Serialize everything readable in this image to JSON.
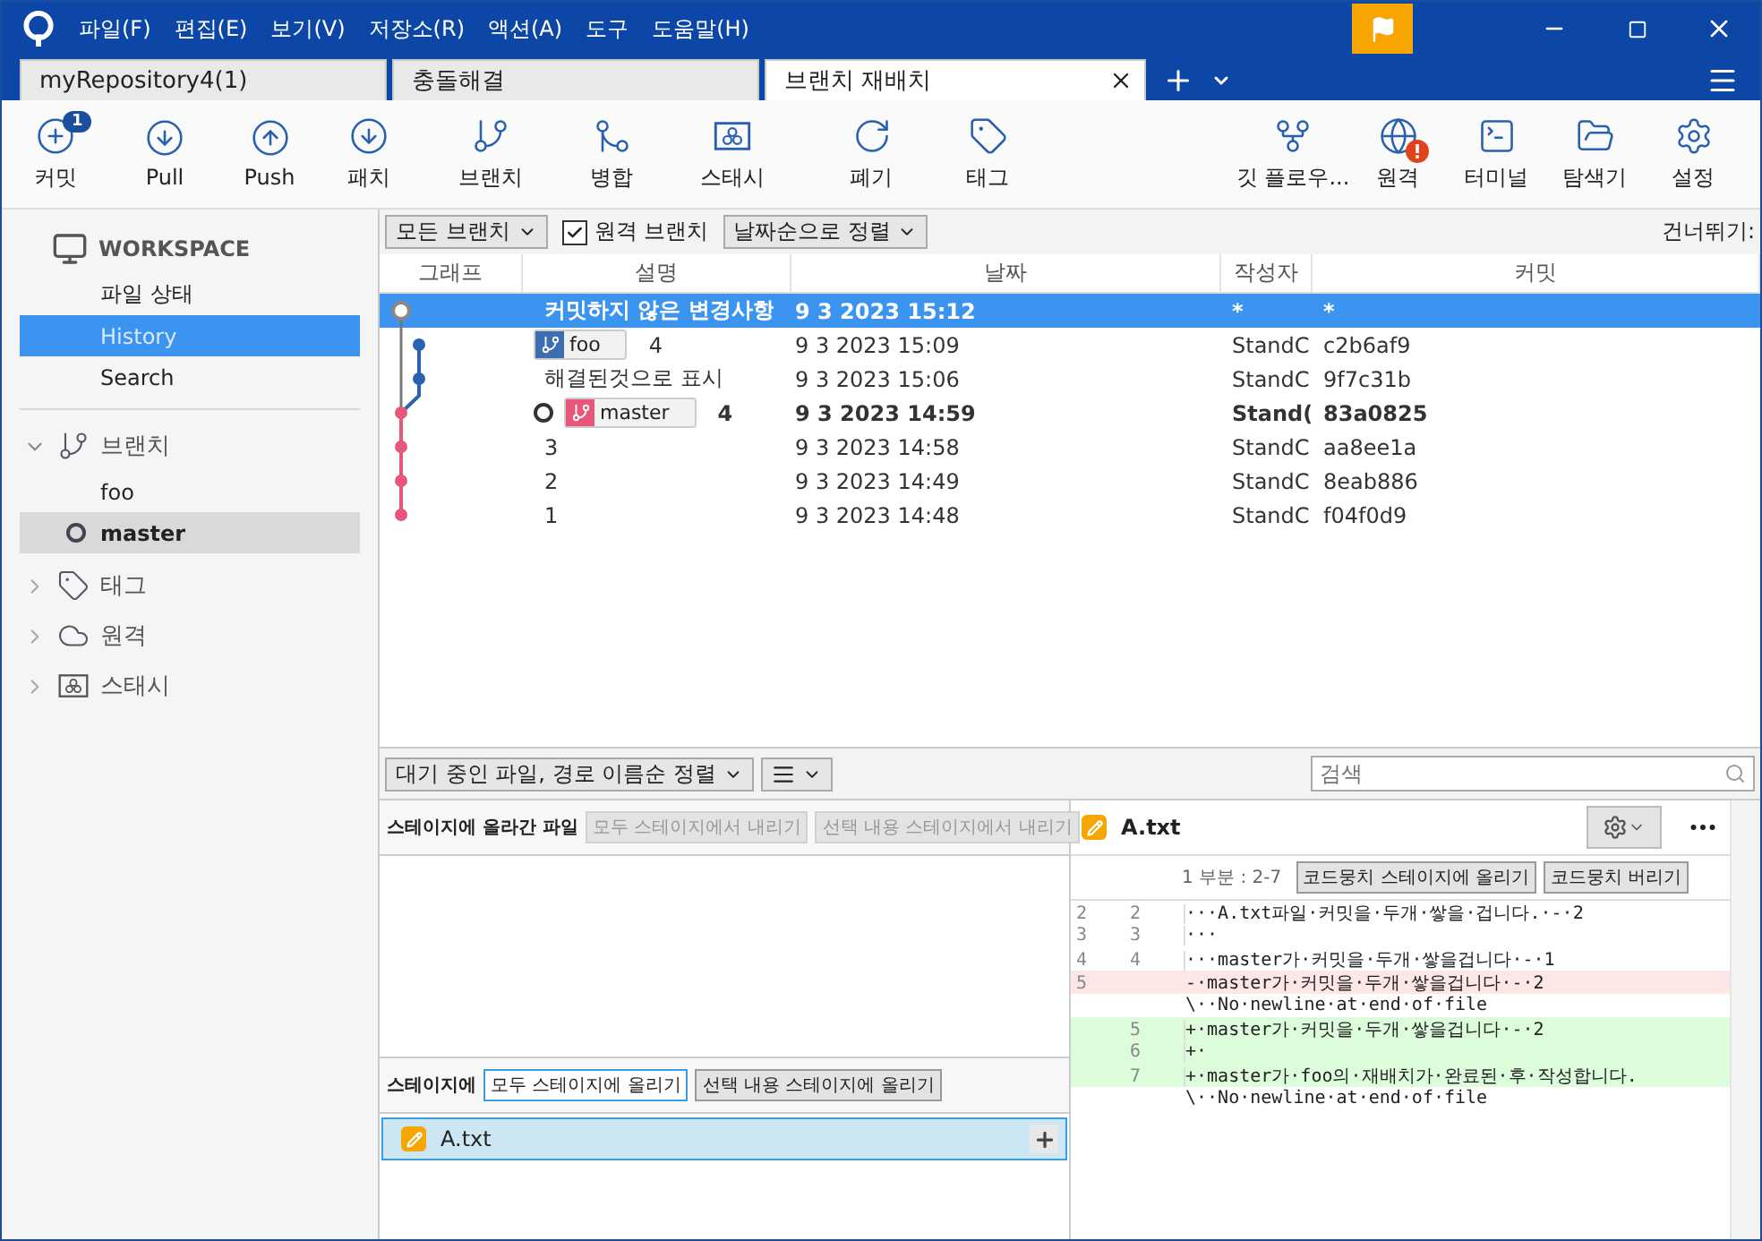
{
  "menu": [
    "파일(F)",
    "편집(E)",
    "보기(V)",
    "저장소(R)",
    "액션(A)",
    "도구",
    "도움말(H)"
  ],
  "tabs": [
    {
      "label": "myRepository4(1)",
      "selected": false
    },
    {
      "label": "충돌해결",
      "selected": false
    },
    {
      "label": "브랜치 재배치",
      "selected": true
    }
  ],
  "toolbar": {
    "left": [
      {
        "label": "커밋",
        "badge": "1"
      },
      {
        "label": "Pull"
      },
      {
        "label": "Push"
      },
      {
        "label": "패치"
      },
      {
        "label": "브랜치"
      },
      {
        "label": "병합"
      },
      {
        "label": "스태시"
      },
      {
        "label": "폐기"
      },
      {
        "label": "태그"
      }
    ],
    "right": [
      {
        "label": "깃 플로우..."
      },
      {
        "label": "원격",
        "alert": true
      },
      {
        "label": "터미널"
      },
      {
        "label": "탐색기"
      },
      {
        "label": "설정"
      }
    ]
  },
  "sidebar": {
    "workspace": {
      "title": "WORKSPACE",
      "items": [
        {
          "label": "파일 상태",
          "selected": false
        },
        {
          "label": "History",
          "selected": true
        },
        {
          "label": "Search",
          "selected": false
        }
      ]
    },
    "sections": [
      {
        "label": "브랜치",
        "expanded": true,
        "items": [
          {
            "label": "foo",
            "current": false
          },
          {
            "label": "master",
            "current": true
          }
        ]
      },
      {
        "label": "태그",
        "expanded": false
      },
      {
        "label": "원격",
        "expanded": false
      },
      {
        "label": "스태시",
        "expanded": false
      }
    ]
  },
  "history": {
    "filters": {
      "branches": "모든 브랜치",
      "remote_branches": {
        "label": "원격 브랜치",
        "checked": true
      },
      "sort": "날짜순으로 정렬",
      "jump": "건너뛰기:"
    },
    "columns": [
      "그래프",
      "설명",
      "날짜",
      "작성자",
      "커밋"
    ],
    "rows": [
      {
        "kind": "uncommitted",
        "selected": true,
        "head": false,
        "refs": [],
        "description": "커밋하지 않은 변경사항",
        "date": "9 3 2023 15:12",
        "author": "*",
        "commit": "*"
      },
      {
        "kind": "commit",
        "selected": false,
        "head": false,
        "refs": [
          {
            "name": "foo",
            "color": "#3d6fb0"
          }
        ],
        "description": "4",
        "date": "9 3 2023 15:09",
        "author": "StandC",
        "commit": "c2b6af9"
      },
      {
        "kind": "commit",
        "selected": false,
        "head": false,
        "refs": [],
        "description": "해결된것으로 표시",
        "date": "9 3 2023 15:06",
        "author": "StandC",
        "commit": "9f7c31b"
      },
      {
        "kind": "commit",
        "selected": false,
        "head": true,
        "refs": [
          {
            "name": "master",
            "color": "#e8577a"
          }
        ],
        "description": "4",
        "date": "9 3 2023 14:59",
        "author": "Stand(",
        "commit": "83a0825"
      },
      {
        "kind": "commit",
        "selected": false,
        "head": false,
        "refs": [],
        "description": "3",
        "date": "9 3 2023 14:58",
        "author": "StandC",
        "commit": "aa8ee1a"
      },
      {
        "kind": "commit",
        "selected": false,
        "head": false,
        "refs": [],
        "description": "2",
        "date": "9 3 2023 14:49",
        "author": "StandC",
        "commit": "8eab886"
      },
      {
        "kind": "commit",
        "selected": false,
        "head": false,
        "refs": [],
        "description": "1",
        "date": "9 3 2023 14:48",
        "author": "StandC",
        "commit": "f04f0d9"
      }
    ]
  },
  "files": {
    "sort": "대기 중인 파일, 경로 이름순 정렬",
    "search": {
      "placeholder": "검색"
    },
    "staged": {
      "title": "스테이지에 올라간 파일",
      "buttons": [
        {
          "label": "모두 스테이지에서 내리기",
          "disabled": true
        },
        {
          "label": "선택 내용 스테이지에서 내리기",
          "disabled": true
        }
      ]
    },
    "unstaged": {
      "title": "스테이지에",
      "buttons": [
        {
          "label": "모두 스테이지에 올리기",
          "disabled": false
        },
        {
          "label": "선택 내용 스테이지에 올리기",
          "disabled": false
        }
      ],
      "items": [
        {
          "name": "A.txt",
          "selected": true
        }
      ]
    }
  },
  "diff": {
    "file": "A.txt",
    "hunk": "1 부분 : 2-7",
    "buttons": [
      "코드뭉치 스테이지에 올리기",
      "코드뭉치 버리기"
    ],
    "lines": [
      {
        "kind": "context",
        "old": "2",
        "new": "2",
        "text": "···A.txt파일·커밋을·두개·쌓을·겁니다.·-·2"
      },
      {
        "kind": "context",
        "old": "3",
        "new": "3",
        "text": "···"
      },
      {
        "kind": "context",
        "old": "4",
        "new": "4",
        "text": "···master가·커밋을·두개·쌓을겁니다·-·1"
      },
      {
        "kind": "removed",
        "old": "5",
        "text": "-·master가·커밋을·두개·쌓을겁니다·-·2"
      },
      {
        "kind": "note",
        "text": "\\··No·newline·at·end·of·file"
      },
      {
        "kind": "added",
        "new": "5",
        "text": "+·master가·커밋을·두개·쌓을겁니다·-·2"
      },
      {
        "kind": "added",
        "new": "6",
        "text": "+·"
      },
      {
        "kind": "added",
        "new": "7",
        "text": "+·master가·foo의·재배치가·완료된·후·작성합니다."
      },
      {
        "kind": "note",
        "text": "\\··No·newline·at·end·of·file"
      }
    ]
  }
}
